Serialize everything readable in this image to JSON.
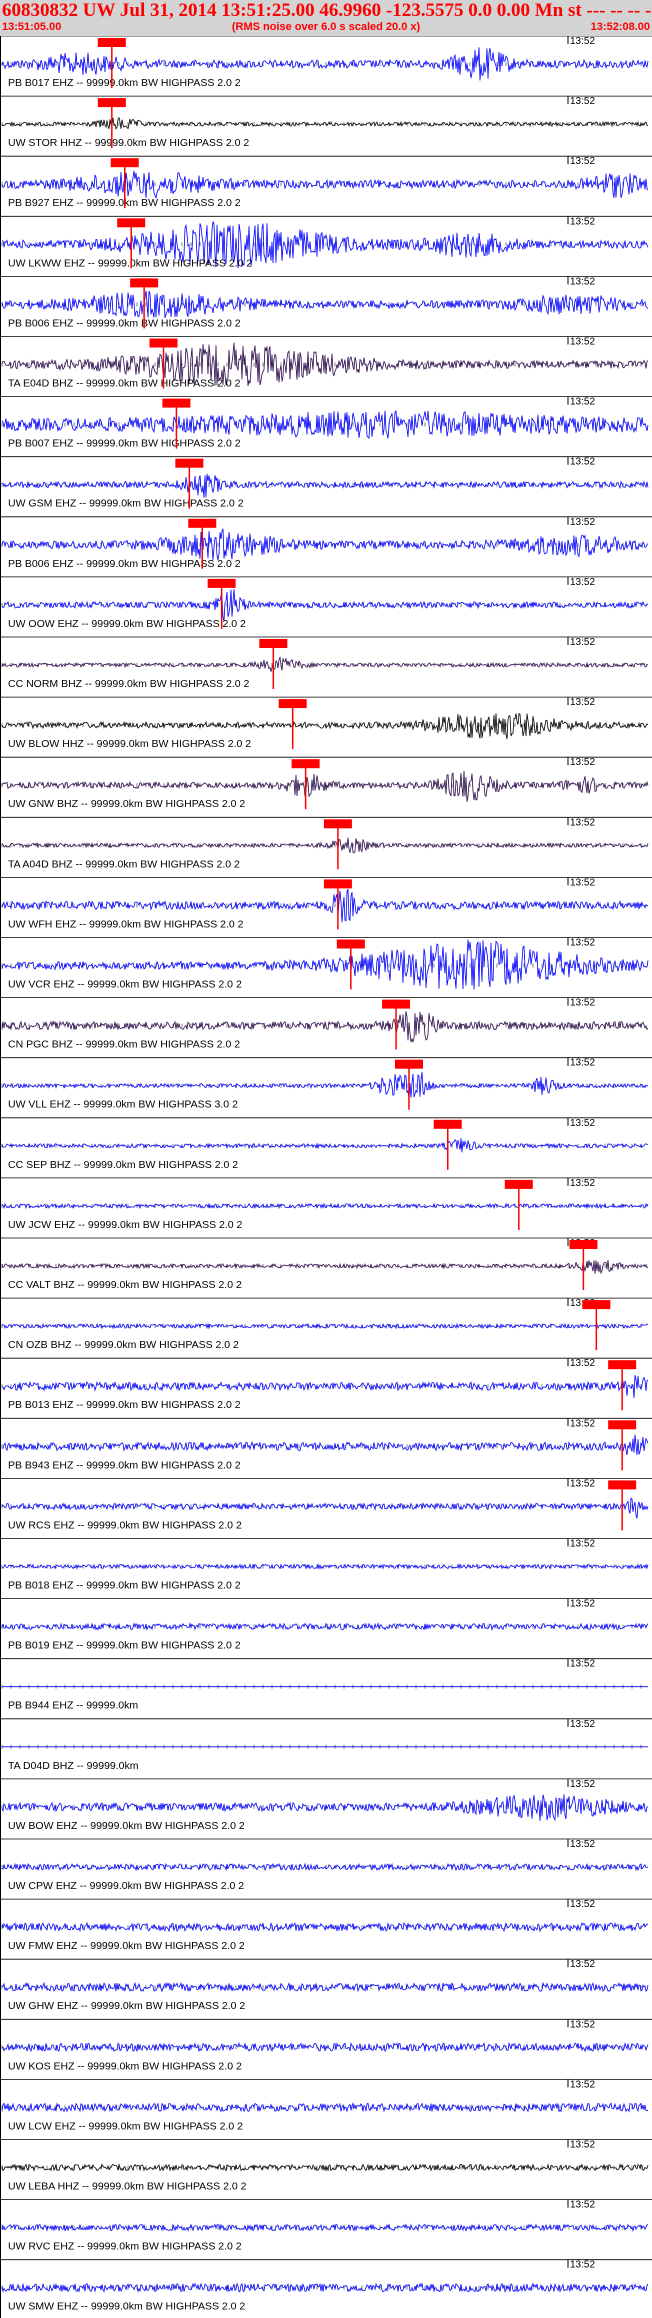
{
  "header": {
    "title": "60830832 UW Jul 31, 2014 13:51:25.00   46.9960 -123.5575  0.0 0.00 Mn st --- -- -- -1",
    "start_time": "13:51:05.00",
    "note": "(RMS noise over 6.0 s scaled 20.0 x)",
    "end_time": "13:52:08.00"
  },
  "colors": {
    "blue": "#0000ff",
    "dark": "#2a0a4a",
    "black": "#000000",
    "pick": "#ff0000",
    "title": "#ff0000",
    "header_bg": "#d3d3d3"
  },
  "chart_data": {
    "type": "line",
    "title": "60830832 UW Jul 31, 2014 13:51:25.00   46.9960 -123.5575  0.0 0.00 Mn st --- -- -- -1",
    "x_range": [
      "13:51:05.00",
      "13:52:08.00"
    ],
    "tick_label": "13:52",
    "series": [
      {
        "name": "PB B017 EHZ -- 99999.0km BW  HIGHPASS  2.0  2",
        "color": "blue",
        "amp": 4,
        "bursts": [
          [
            0.12,
            0.06,
            8
          ],
          [
            0.74,
            0.04,
            14
          ]
        ],
        "pick": 0.17
      },
      {
        "name": "UW STOR HHZ -- 99999.0km BW  HIGHPASS  2.0  2",
        "color": "black",
        "amp": 2,
        "bursts": [
          [
            0.18,
            0.03,
            5
          ]
        ],
        "pick": 0.17
      },
      {
        "name": "PB B927 EHZ -- 99999.0km BW  HIGHPASS  2.0  2",
        "color": "blue",
        "amp": 4,
        "bursts": [
          [
            0.22,
            0.1,
            10
          ],
          [
            0.95,
            0.04,
            10
          ]
        ],
        "pick": 0.19
      },
      {
        "name": "UW LKWW EHZ -- 99999.0km BW  HIGHPASS  2.0  2",
        "color": "blue",
        "amp": 4,
        "bursts": [
          [
            0.36,
            0.14,
            20
          ],
          [
            0.72,
            0.06,
            10
          ]
        ],
        "pick": 0.2
      },
      {
        "name": "PB B006 EHZ -- 99999.0km BW  HIGHPASS  2.0  2",
        "color": "blue",
        "amp": 4,
        "bursts": [
          [
            0.24,
            0.12,
            10
          ],
          [
            0.88,
            0.08,
            7
          ]
        ],
        "pick": 0.22
      },
      {
        "name": "TA E04D BHZ -- 99999.0km BW  HIGHPASS  2.0  2",
        "color": "dark",
        "amp": 4,
        "bursts": [
          [
            0.36,
            0.16,
            18
          ]
        ],
        "pick": 0.25
      },
      {
        "name": "PB B007 EHZ -- 99999.0km BW  HIGHPASS  2.0  2",
        "color": "blue",
        "amp": 6,
        "bursts": [
          [
            0.6,
            0.3,
            8
          ]
        ],
        "pick": 0.27
      },
      {
        "name": "UW GSM EHZ -- 99999.0km BW  HIGHPASS  2.0  2",
        "color": "blue",
        "amp": 3,
        "bursts": [
          [
            0.31,
            0.03,
            10
          ]
        ],
        "pick": 0.29
      },
      {
        "name": "PB B006 EHZ -- 99999.0km BW  HIGHPASS  2.0  2",
        "color": "blue",
        "amp": 4,
        "bursts": [
          [
            0.34,
            0.08,
            12
          ],
          [
            0.88,
            0.08,
            8
          ]
        ],
        "pick": 0.31
      },
      {
        "name": "UW OOW EHZ -- 99999.0km BW  HIGHPASS  2.0  2",
        "color": "blue",
        "amp": 3,
        "bursts": [
          [
            0.35,
            0.02,
            16
          ]
        ],
        "pick": 0.34
      },
      {
        "name": "CC NORM BHZ -- 99999.0km BW  HIGHPASS  2.0  2",
        "color": "dark",
        "amp": 2,
        "bursts": [
          [
            0.43,
            0.03,
            6
          ]
        ],
        "pick": 0.42
      },
      {
        "name": "UW BLOW HHZ -- 99999.0km BW  HIGHPASS  2.0  2",
        "color": "black",
        "amp": 3,
        "bursts": [
          [
            0.76,
            0.09,
            12
          ]
        ],
        "pick": 0.45
      },
      {
        "name": "UW GNW BHZ -- 99999.0km BW  HIGHPASS  2.0  2",
        "color": "dark",
        "amp": 3,
        "bursts": [
          [
            0.47,
            0.03,
            10
          ],
          [
            0.72,
            0.04,
            14
          ],
          [
            0.9,
            0.03,
            6
          ]
        ],
        "pick": 0.47
      },
      {
        "name": "TA A04D BHZ -- 99999.0km BW  HIGHPASS  2.0  2",
        "color": "dark",
        "amp": 2,
        "bursts": [
          [
            0.54,
            0.03,
            6
          ]
        ],
        "pick": 0.52
      },
      {
        "name": "UW WFH EHZ -- 99999.0km BW  HIGHPASS  2.0  2",
        "color": "blue",
        "amp": 4,
        "bursts": [
          [
            0.53,
            0.02,
            14
          ]
        ],
        "pick": 0.52
      },
      {
        "name": "UW VCR EHZ -- 99999.0km BW  HIGHPASS  2.0  2",
        "color": "blue",
        "amp": 4,
        "bursts": [
          [
            0.72,
            0.16,
            22
          ]
        ],
        "pick": 0.54
      },
      {
        "name": "CN PGC BHZ -- 99999.0km BW  HIGHPASS  2.0  2",
        "color": "dark",
        "amp": 4,
        "bursts": [
          [
            0.64,
            0.03,
            14
          ]
        ],
        "pick": 0.61
      },
      {
        "name": "UW VLL EHZ -- 99999.0km BW  HIGHPASS  3.0  2",
        "color": "blue",
        "amp": 2,
        "bursts": [
          [
            0.6,
            0.02,
            10
          ],
          [
            0.64,
            0.02,
            16
          ],
          [
            0.84,
            0.02,
            8
          ]
        ],
        "pick": 0.63
      },
      {
        "name": "CC SEP BHZ -- 99999.0km BW  HIGHPASS  2.0  2",
        "color": "blue",
        "amp": 2,
        "bursts": [
          [
            0.71,
            0.02,
            6
          ]
        ],
        "pick": 0.69
      },
      {
        "name": "UW JCW EHZ -- 99999.0km BW  HIGHPASS  2.0  2",
        "color": "blue",
        "amp": 2,
        "bursts": [],
        "pick": 0.8
      },
      {
        "name": "CC VALT BHZ -- 99999.0km BW  HIGHPASS  2.0  2",
        "color": "dark",
        "amp": 2,
        "bursts": [
          [
            0.92,
            0.03,
            6
          ]
        ],
        "pick": 0.9
      },
      {
        "name": "CN OZB BHZ -- 99999.0km BW  HIGHPASS  2.0  2",
        "color": "blue",
        "amp": 2,
        "bursts": [],
        "pick": 0.92
      },
      {
        "name": "PB B013 EHZ -- 99999.0km BW  HIGHPASS  2.0  2",
        "color": "blue",
        "amp": 4,
        "bursts": [
          [
            0.98,
            0.02,
            8
          ]
        ],
        "pick": 0.96
      },
      {
        "name": "PB B943 EHZ -- 99999.0km BW  HIGHPASS  2.0  2",
        "color": "blue",
        "amp": 4,
        "bursts": [
          [
            0.98,
            0.02,
            8
          ]
        ],
        "pick": 0.96
      },
      {
        "name": "UW RCS EHZ -- 99999.0km BW  HIGHPASS  2.0  2",
        "color": "blue",
        "amp": 3,
        "bursts": [
          [
            0.98,
            0.01,
            10
          ]
        ],
        "pick": 0.96
      },
      {
        "name": "PB B018 EHZ -- 99999.0km BW  HIGHPASS  2.0  2",
        "color": "blue",
        "amp": 2,
        "bursts": []
      },
      {
        "name": "PB B019 EHZ -- 99999.0km BW  HIGHPASS  2.0  2",
        "color": "blue",
        "amp": 3,
        "bursts": []
      },
      {
        "name": "PB B944 EHZ -- 99999.0km",
        "color": "blue",
        "amp": 0,
        "bursts": []
      },
      {
        "name": "TA D04D BHZ -- 99999.0km",
        "color": "blue",
        "amp": 0,
        "bursts": []
      },
      {
        "name": "UW BOW EHZ -- 99999.0km BW  HIGHPASS  2.0  2",
        "color": "blue",
        "amp": 4,
        "bursts": [
          [
            0.84,
            0.1,
            10
          ]
        ]
      },
      {
        "name": "UW CPW EHZ -- 99999.0km BW  HIGHPASS  2.0  2",
        "color": "blue",
        "amp": 3,
        "bursts": []
      },
      {
        "name": "UW FMW EHZ -- 99999.0km BW  HIGHPASS  2.0  2",
        "color": "blue",
        "amp": 4,
        "bursts": []
      },
      {
        "name": "UW GHW EHZ -- 99999.0km BW  HIGHPASS  2.0  2",
        "color": "blue",
        "amp": 4,
        "bursts": []
      },
      {
        "name": "UW KOS EHZ -- 99999.0km BW  HIGHPASS  2.0  2",
        "color": "blue",
        "amp": 4,
        "bursts": []
      },
      {
        "name": "UW LCW EHZ -- 99999.0km BW  HIGHPASS  2.0  2",
        "color": "blue",
        "amp": 4,
        "bursts": []
      },
      {
        "name": "UW LEBA HHZ -- 99999.0km BW  HIGHPASS  2.0  2",
        "color": "black",
        "amp": 3,
        "bursts": []
      },
      {
        "name": "UW RVC EHZ -- 99999.0km BW  HIGHPASS  2.0  2",
        "color": "blue",
        "amp": 3,
        "bursts": []
      },
      {
        "name": "UW SMW EHZ -- 99999.0km BW  HIGHPASS  2.0  2",
        "color": "blue",
        "amp": 4,
        "bursts": []
      }
    ]
  }
}
